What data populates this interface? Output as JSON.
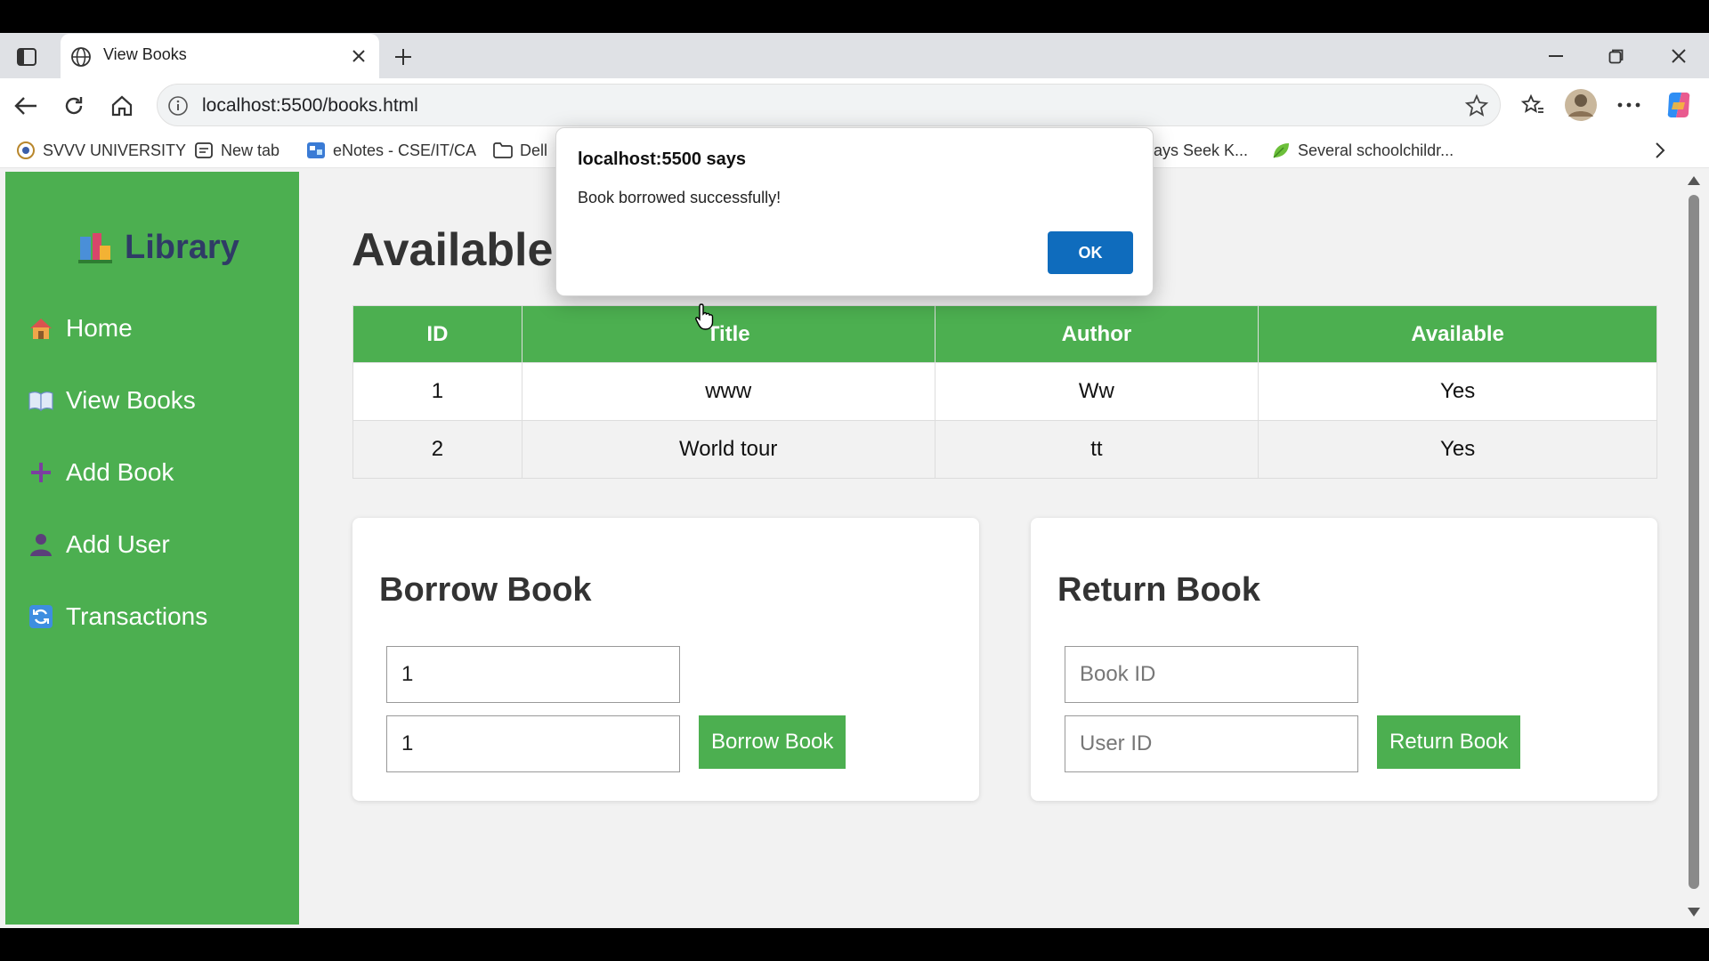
{
  "browser": {
    "tab_title": "View Books",
    "url": "localhost:5500/books.html",
    "bookmarks": [
      {
        "label": "SVVV UNIVERSITY",
        "icon": "university-icon"
      },
      {
        "label": "New tab",
        "icon": "newtab-icon"
      },
      {
        "label": "eNotes - CSE/IT/CA",
        "icon": "enotes-icon"
      },
      {
        "label": "Dell",
        "icon": "folder-icon"
      },
      {
        "label": "ays Seek K...",
        "icon": "page-icon"
      },
      {
        "label": "Several schoolchildr...",
        "icon": "leaf-icon"
      }
    ]
  },
  "sidebar": {
    "logo": "Library",
    "items": [
      {
        "label": "Home",
        "icon": "house-icon"
      },
      {
        "label": "View Books",
        "icon": "book-icon"
      },
      {
        "label": "Add Book",
        "icon": "plus-icon"
      },
      {
        "label": "Add User",
        "icon": "user-icon"
      },
      {
        "label": "Transactions",
        "icon": "refresh-icon"
      }
    ]
  },
  "main": {
    "title": "Available Books",
    "table": {
      "headers": [
        "ID",
        "Title",
        "Author",
        "Available"
      ],
      "rows": [
        [
          "1",
          "www",
          "Ww",
          "Yes"
        ],
        [
          "2",
          "World tour",
          "tt",
          "Yes"
        ]
      ]
    },
    "borrow": {
      "heading": "Borrow Book",
      "book_id_value": "1",
      "user_id_value": "1",
      "button": "Borrow Book"
    },
    "return": {
      "heading": "Return Book",
      "book_id_placeholder": "Book ID",
      "user_id_placeholder": "User ID",
      "button": "Return Book"
    }
  },
  "dialog": {
    "title": "localhost:5500 says",
    "message": "Book borrowed successfully!",
    "ok": "OK"
  },
  "colors": {
    "accent_green": "#4caf50",
    "dialog_button": "#0f6cbd",
    "logo_text": "#2f3b66"
  }
}
